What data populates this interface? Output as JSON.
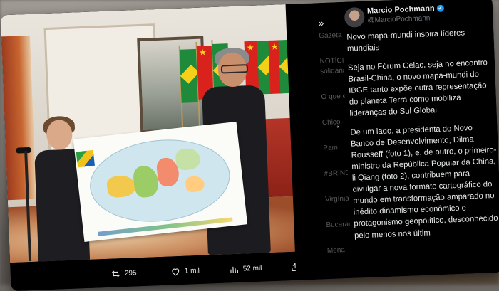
{
  "tweet": {
    "author_name": "Marcio Pochmann",
    "author_handle": "@MarcioPochmann",
    "title": "Novo mapa-mundi inspira líderes mundiais",
    "paragraphs": [
      "Seja no Fórum Celac, seja no encontro Brasil-China, o novo mapa-mundi do IBGE tanto expõe outra representação do planeta Terra como mobiliza lideranças do Sul Global.",
      "De um lado, a presidenta do Novo Banco de Desenvolvimento, Dilma Rousseff (foto 1), e, de outro, o primeiro-ministro da República Popular da China, li Qiang (foto 2), contribuem para divulgar a nova formato cartográfico do mundo em transformação amparado no inédito dinamismo econômico e protagonismo geopolítico, desconhecido pelo menos nos últim"
    ]
  },
  "actions": {
    "retweets": "295",
    "likes": "1 mil",
    "views": "52 mil"
  },
  "background_panel": {
    "items": [
      "Gazeta",
      "NOTÍCIAS solidária",
      "O que e",
      "Chico",
      "Pam",
      "#BRINDAR",
      "Virgínia Fons",
      "Bucaramang",
      "Mena"
    ]
  },
  "icons": {
    "collapse": "chevrons-right-icon",
    "next": "arrow-right-icon",
    "verified": "verified-badge-icon"
  },
  "colors": {
    "accent": "#1d9bf0",
    "background": "#000000",
    "text": "#e7e9ea",
    "muted": "#71767b"
  }
}
